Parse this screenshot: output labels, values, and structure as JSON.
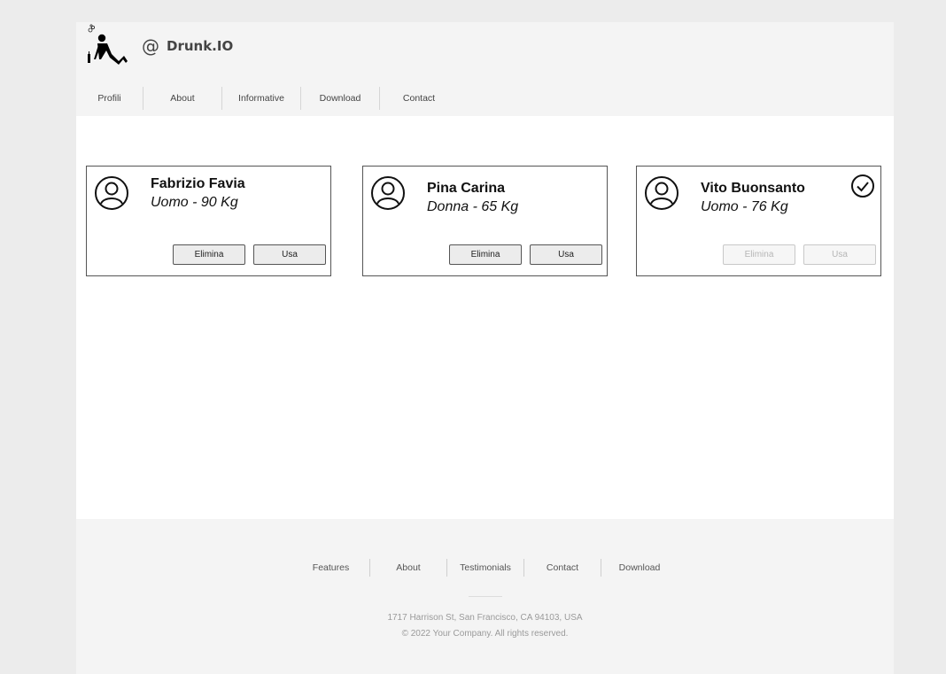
{
  "header": {
    "brand_at": "@",
    "brand_name": "Drunk.IO",
    "nav": [
      "Profili",
      "About",
      "Informative",
      "Download",
      "Contact"
    ]
  },
  "profiles": [
    {
      "name": "Fabrizio Favia",
      "info": "Uomo - 90 Kg",
      "delete_label": "Elimina",
      "use_label": "Usa",
      "selected": false
    },
    {
      "name": "Pina Carina",
      "info": "Donna - 65 Kg",
      "delete_label": "Elimina",
      "use_label": "Usa",
      "selected": false
    },
    {
      "name": "Vito Buonsanto",
      "info": "Uomo - 76 Kg",
      "delete_label": "Elimina",
      "use_label": "Usa",
      "selected": true
    }
  ],
  "footer": {
    "nav": [
      "Features",
      "About",
      "Testimonials",
      "Contact",
      "Download"
    ],
    "address": "1717 Harrison St, San Francisco, CA 94103, USA",
    "copyright": "© 2022 Your Company.  All rights reserved."
  },
  "icons": {
    "logo": "drunk-person-logo-icon",
    "avatar": "user-circle-icon",
    "selected": "check-circle-icon"
  },
  "colors": {
    "page_background": "#ececec",
    "header_background": "#f4f4f4",
    "content_background": "#ffffff",
    "button_background": "#ececec",
    "disabled_text": "#b6b6b6"
  }
}
